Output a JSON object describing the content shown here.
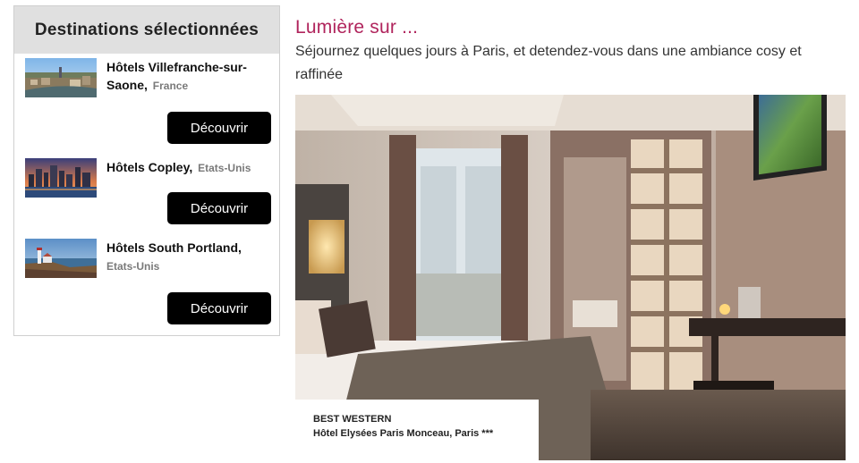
{
  "sidebar": {
    "title": "Destinations sélectionnées",
    "items": [
      {
        "name": "Hôtels Villefranche-sur-Saone,",
        "country": "France",
        "button": "Découvrir"
      },
      {
        "name": "Hôtels Copley,",
        "country": "Etats-Unis",
        "button": "Découvrir"
      },
      {
        "name": "Hôtels South Portland,",
        "country": "Etats-Unis",
        "button": "Découvrir"
      }
    ]
  },
  "main": {
    "title": "Lumière sur ...",
    "description": "Séjournez quelques jours à Paris, et detendez-vous dans une ambiance cosy et raffinée",
    "caption": {
      "brand": "BEST WESTERN",
      "hotel": "Hôtel Elysées Paris Monceau, Paris ***"
    }
  },
  "colors": {
    "accent": "#b0245c",
    "button_bg": "#000000",
    "header_bg": "#e0e0e0"
  }
}
